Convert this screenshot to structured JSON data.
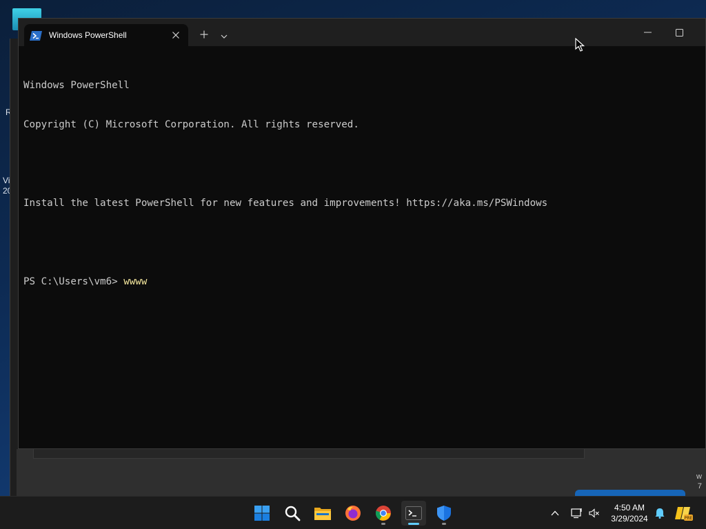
{
  "desktop": {
    "left_text_1": "R",
    "left_text_2": "Vi",
    "left_text_3": "20",
    "right_text_1": "w",
    "right_text_2": "7"
  },
  "terminal": {
    "tab_title": "Windows PowerShell",
    "lines": [
      "Windows PowerShell",
      "Copyright (C) Microsoft Corporation. All rights reserved.",
      "",
      "Install the latest PowerShell for new features and improvements! https://aka.ms/PSWindows",
      ""
    ],
    "prompt": "PS C:\\Users\\vm6> ",
    "typed_command": "wwww",
    "new_tab_icon": "plus-icon",
    "dropdown_icon": "chevron-down-icon"
  },
  "taskbar": {
    "apps": [
      {
        "name": "start",
        "icon": "windows-logo-icon"
      },
      {
        "name": "search",
        "icon": "search-icon"
      },
      {
        "name": "file-explorer",
        "icon": "folder-icon"
      },
      {
        "name": "firefox",
        "icon": "firefox-icon"
      },
      {
        "name": "chrome",
        "icon": "chrome-icon"
      },
      {
        "name": "terminal",
        "icon": "terminal-icon"
      },
      {
        "name": "defender",
        "icon": "shield-icon"
      }
    ],
    "clock": {
      "time": "4:50 AM",
      "date": "3/29/2024"
    }
  },
  "colors": {
    "terminal_bg": "#0c0c0c",
    "terminal_text": "#cccccc",
    "command_text": "#f2e59c",
    "accent": "#60cdff"
  }
}
